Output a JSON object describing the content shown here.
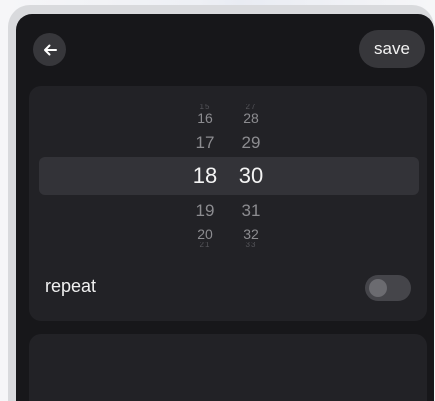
{
  "header": {
    "back_icon": "arrow-left-icon",
    "save_label": "save"
  },
  "time_picker": {
    "hours": {
      "above_far": "15",
      "above_2": "16",
      "above_1": "17",
      "selected": "18",
      "below_1": "19",
      "below_2": "20",
      "below_far": "21"
    },
    "minutes": {
      "above_far": "27",
      "above_2": "28",
      "above_1": "29",
      "selected": "30",
      "below_1": "31",
      "below_2": "32",
      "below_far": "33"
    }
  },
  "repeat": {
    "label": "repeat",
    "enabled": false
  },
  "colors": {
    "screen_bg": "#17171a",
    "card_bg": "#222226",
    "selected_row_bg": "#333338",
    "button_bg": "#37373b"
  }
}
